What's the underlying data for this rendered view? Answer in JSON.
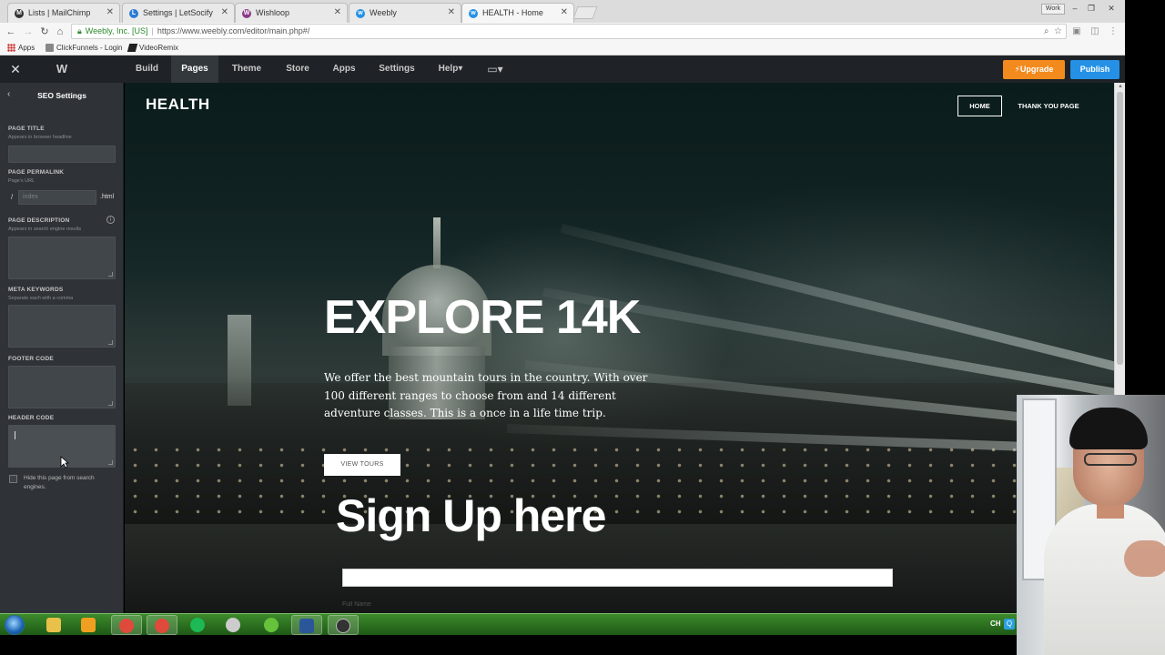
{
  "browser": {
    "tabs": [
      {
        "title": "Lists | MailChimp",
        "icon": "mailchimp-icon",
        "color": "#333333"
      },
      {
        "title": "Settings | LetSocify",
        "icon": "letsocify-icon",
        "color": "#2b7bd6"
      },
      {
        "title": "Wishloop",
        "icon": "wishloop-icon",
        "color": "#8a3a8a"
      },
      {
        "title": "Weebly",
        "icon": "weebly-icon",
        "color": "#2491e6"
      },
      {
        "title": "HEALTH - Home",
        "icon": "weebly-icon",
        "color": "#2491e6"
      }
    ],
    "active_tab_index": 4,
    "profile_label": "Work",
    "address": {
      "secure_label": "Weebly, Inc. [US]",
      "url": "https://www.weebly.com/editor/main.php#/"
    },
    "bookmarks": [
      {
        "label": "Apps",
        "icon": "apps-grid-icon"
      },
      {
        "label": "ClickFunnels - Login",
        "icon": "clickfunnels-icon"
      },
      {
        "label": "VideoRemix",
        "icon": "videoremix-icon"
      }
    ]
  },
  "editor": {
    "nav": [
      "Build",
      "Pages",
      "Theme",
      "Store",
      "Apps",
      "Settings",
      "Help"
    ],
    "active_nav": "Pages",
    "help_suffix": "▾",
    "upgrade_label": "Upgrade",
    "publish_label": "Publish",
    "accent_upgrade": "#f28a1e",
    "accent_publish": "#2491e6"
  },
  "sidebar": {
    "title": "SEO Settings",
    "page_title": {
      "label": "PAGE TITLE",
      "hint": "Appears in browser headline",
      "value": ""
    },
    "permalink": {
      "label": "PAGE PERMALINK",
      "hint": "Page's URL",
      "slash": "/",
      "placeholder": "index",
      "suffix": ".html"
    },
    "description": {
      "label": "PAGE DESCRIPTION",
      "hint": "Appears in search engine results",
      "value": ""
    },
    "keywords": {
      "label": "META KEYWORDS",
      "hint": "Separate each with a comma",
      "value": ""
    },
    "footer_code": {
      "label": "FOOTER CODE",
      "value": ""
    },
    "header_code": {
      "label": "HEADER CODE",
      "value": ""
    },
    "hide_page": {
      "label": "Hide this page from search engines.",
      "checked": false
    }
  },
  "site": {
    "logo": "HEALTH",
    "nav": [
      "HOME",
      "THANK YOU PAGE"
    ],
    "hero_title": "EXPLORE 14K",
    "hero_body": "We offer the best mountain tours in the country. With over 100 different ranges to choose from and 14 different adventure classes. This is a once in a life time trip.",
    "hero_button": "VIEW TOURS",
    "signup_title": "Sign Up here",
    "signup_field_label": "Full Name"
  },
  "taskbar": {
    "items": [
      {
        "icon": "file-explorer-icon",
        "color": "#e8c04a",
        "open": false
      },
      {
        "icon": "media-player-icon",
        "color": "#f0a020",
        "open": false
      },
      {
        "icon": "chrome-icon",
        "color": "#e04a3a",
        "open": true
      },
      {
        "icon": "chrome-icon",
        "color": "#e04a3a",
        "open": true
      },
      {
        "icon": "spotify-icon",
        "color": "#1db954",
        "open": false
      },
      {
        "icon": "network-icon",
        "color": "#cccccc",
        "open": false
      },
      {
        "icon": "utorrent-icon",
        "color": "#66c23a",
        "open": false
      },
      {
        "icon": "word-icon",
        "color": "#2b579a",
        "open": true
      },
      {
        "icon": "obs-icon",
        "color": "#333333",
        "open": true
      }
    ],
    "tray_lang": "CH"
  }
}
